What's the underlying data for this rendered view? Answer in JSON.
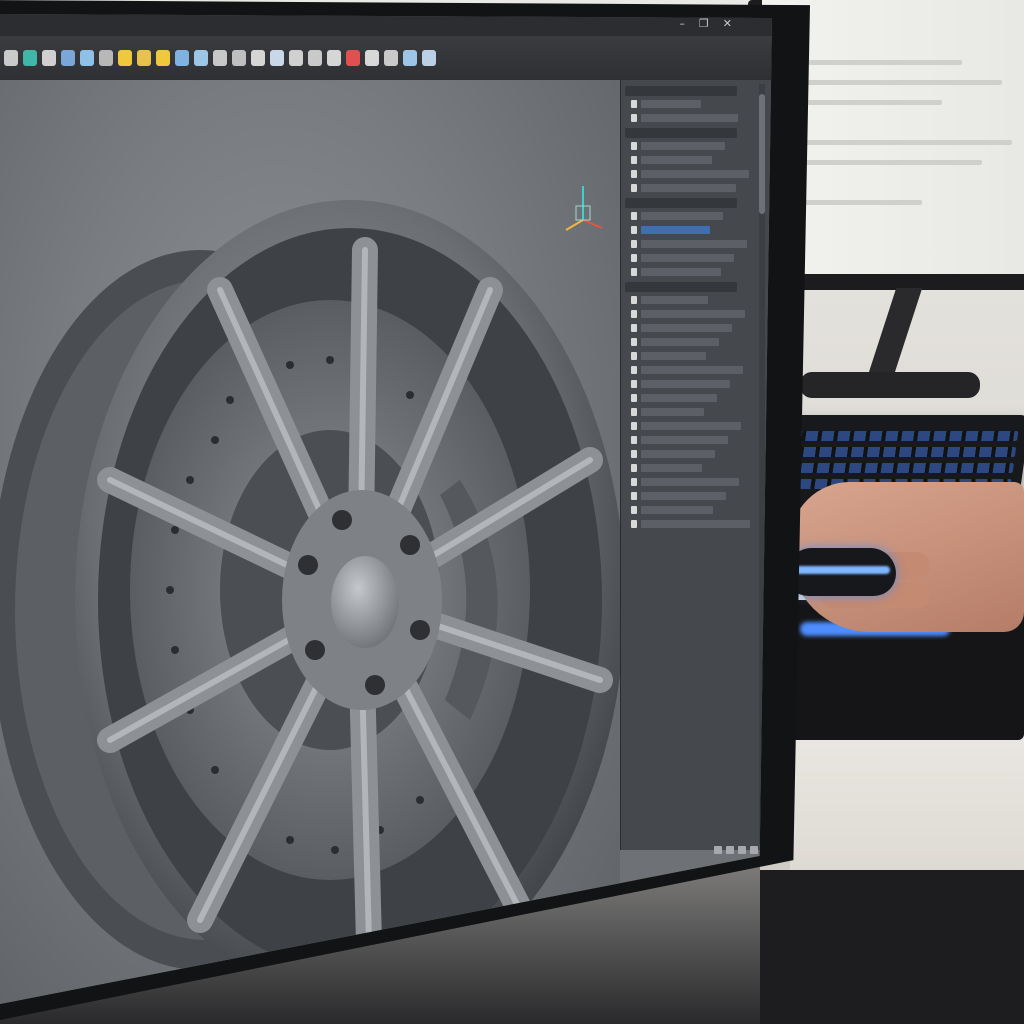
{
  "window": {
    "controls": {
      "minimize": "–",
      "restore": "❐",
      "close": "✕"
    }
  },
  "toolbar": {
    "tools": [
      {
        "icon": "pencil-icon",
        "color": "#c9c9c9"
      },
      {
        "icon": "sphere-icon",
        "color": "#3fb6a8"
      },
      {
        "icon": "brush-icon",
        "color": "#d0d0d0"
      },
      {
        "icon": "cube-icon",
        "color": "#7aa7d8"
      },
      {
        "icon": "globe-icon",
        "color": "#8ec0e8"
      },
      {
        "icon": "gear-icon",
        "color": "#b8b8b8"
      },
      {
        "icon": "bulb-icon",
        "color": "#f0c93a"
      },
      {
        "icon": "folder-icon",
        "color": "#e8c24a"
      },
      {
        "icon": "hand-icon",
        "color": "#f0c93a"
      },
      {
        "icon": "shield-icon",
        "color": "#7fb2e0"
      },
      {
        "icon": "cube-outline-icon",
        "color": "#9cc6e8"
      },
      {
        "icon": "trash-icon",
        "color": "#c8c8c8"
      },
      {
        "icon": "grid-icon",
        "color": "#bfbfbf"
      },
      {
        "icon": "document-icon",
        "color": "#d5d5d5"
      },
      {
        "icon": "sheet-icon",
        "color": "#c9d8e8"
      },
      {
        "icon": "copy-icon",
        "color": "#d0d0d0"
      },
      {
        "icon": "target-icon",
        "color": "#c9c9c9"
      },
      {
        "icon": "zoom-icon",
        "color": "#d6d6d6"
      },
      {
        "icon": "record-icon",
        "color": "#e05050"
      },
      {
        "icon": "page-icon",
        "color": "#d8d8d8"
      },
      {
        "icon": "hook-icon",
        "color": "#c9c9c9"
      },
      {
        "icon": "screen-icon",
        "color": "#9ec4e6"
      },
      {
        "icon": "chart-icon",
        "color": "#b9d0e6"
      }
    ]
  },
  "feature_tree": {
    "sections": 4,
    "rows": 28,
    "selected_row": 7
  },
  "colors": {
    "accent": "#3f6fb0",
    "viewport": "#7b7e82",
    "panel": "#45484c",
    "keyboard_backlight": "#4d8dff"
  }
}
